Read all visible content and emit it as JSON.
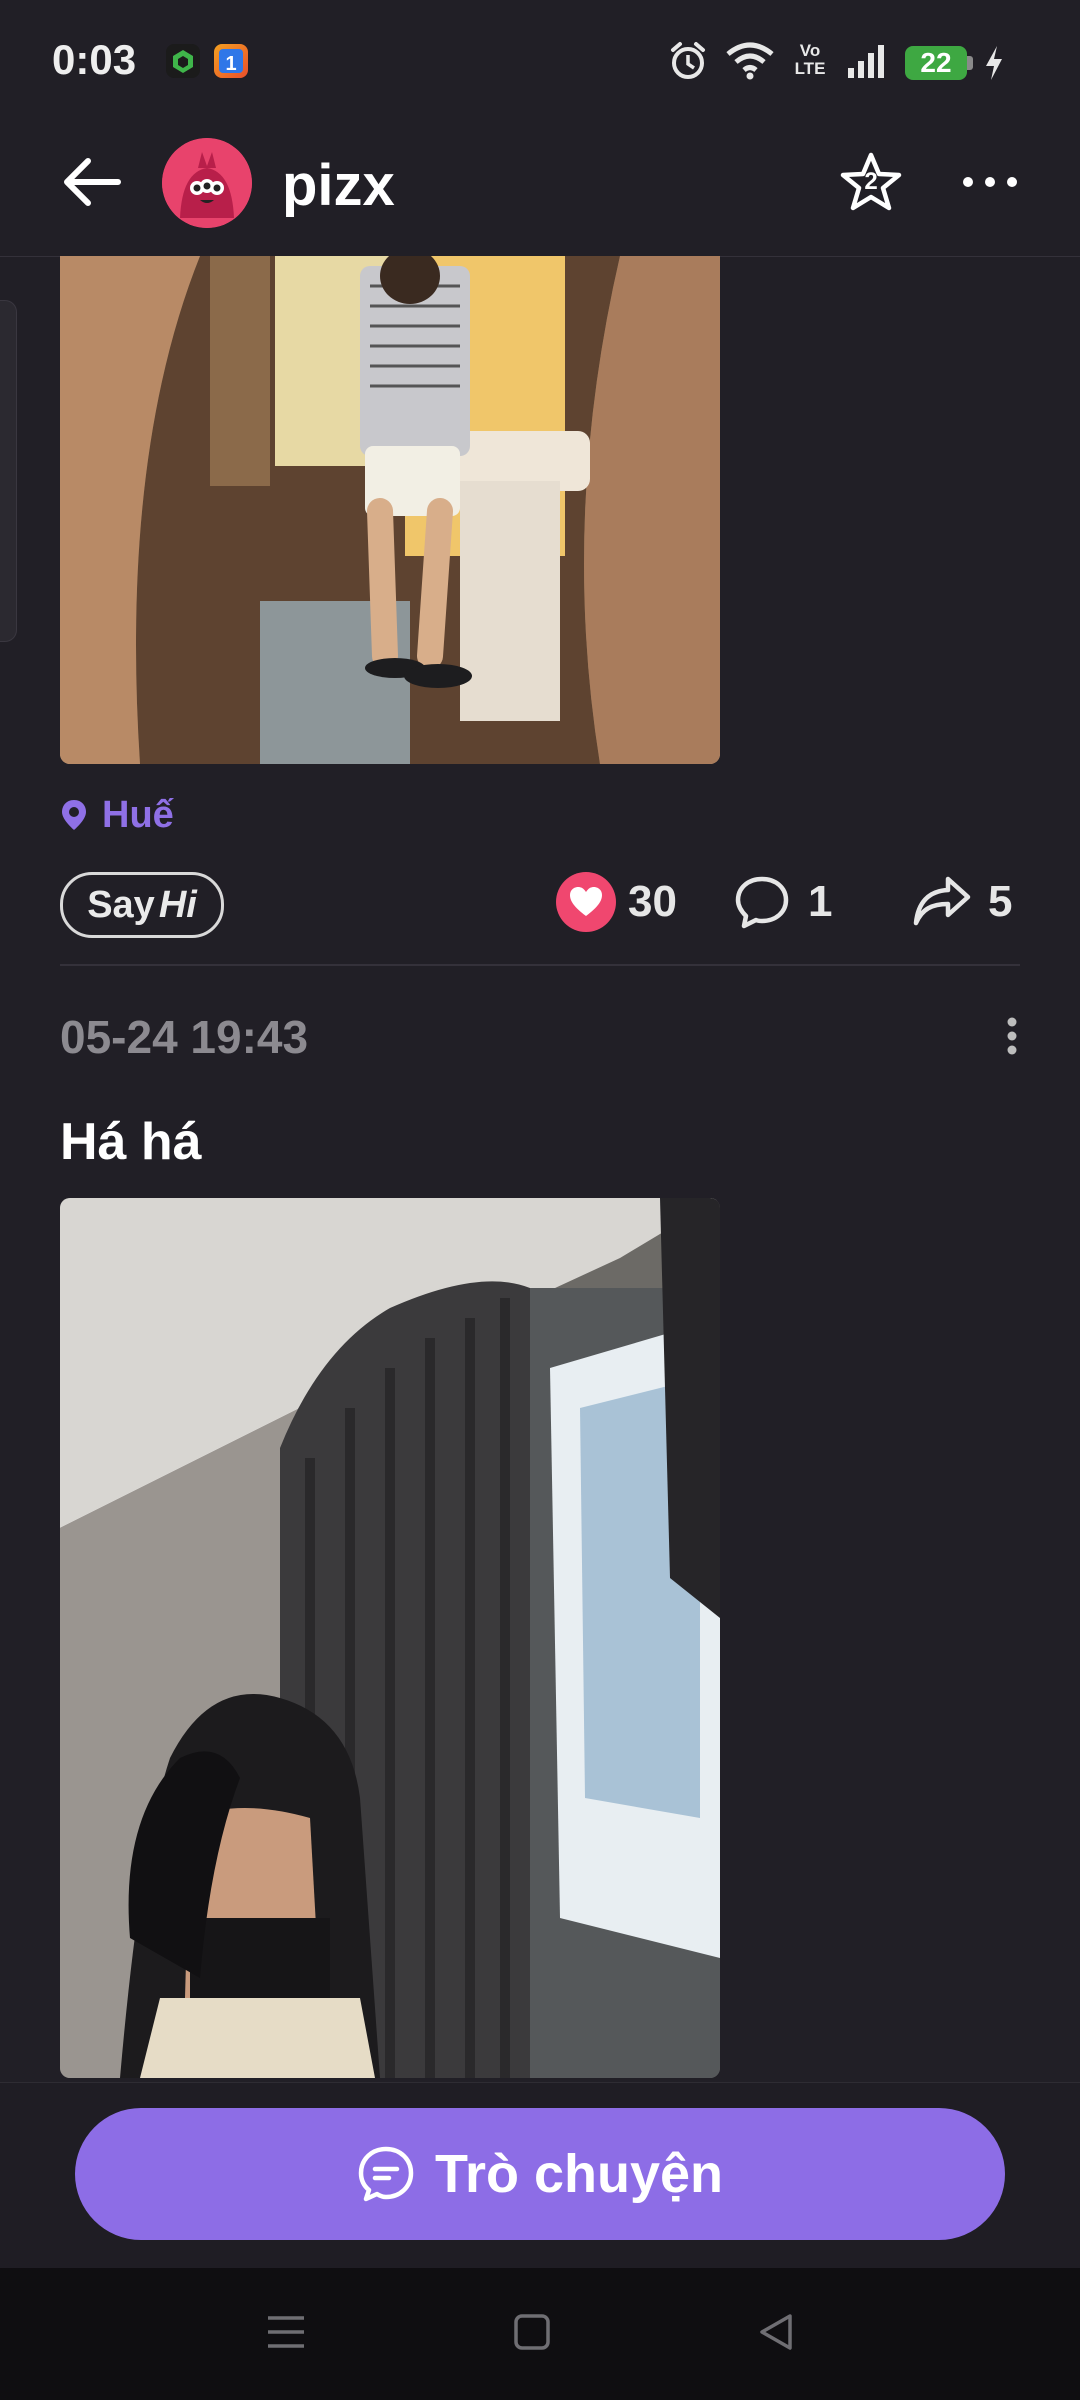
{
  "status_bar": {
    "time": "0:03",
    "network": "Vo LTE",
    "battery": "22"
  },
  "header": {
    "username": "pizx",
    "star_badge": "2"
  },
  "post1": {
    "location": "Huế",
    "sayhi_say": "Say",
    "sayhi_hi": "Hi",
    "likes": "30",
    "comments": "1",
    "shares": "5"
  },
  "post2": {
    "timestamp": "05-24 19:43",
    "title": "Há há"
  },
  "chat_button": {
    "label": "Trò chuyện"
  },
  "colors": {
    "background": "#211f26",
    "accent": "#8d6de6",
    "like": "#f0476f"
  },
  "icons": [
    "back-arrow-icon",
    "star-icon",
    "more-icon",
    "location-pin-icon",
    "heart-icon",
    "comment-icon",
    "share-icon",
    "post-menu-icon",
    "chat-icon",
    "nav-menu-icon",
    "nav-home-icon",
    "nav-back-icon"
  ]
}
